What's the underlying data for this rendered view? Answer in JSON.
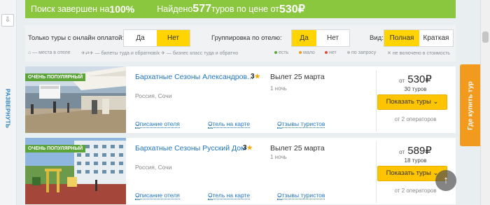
{
  "left": {
    "vertical_text": "РАЗВЕРНУТЬ"
  },
  "status": {
    "search_text": "Поиск завершен на ",
    "search_percent": "100%",
    "found_prefix": "Найдено ",
    "found_count": "577",
    "found_middle": " туров по цене от ",
    "found_price": "530₽"
  },
  "filters": {
    "online_label": "Только туры с онлайн оплатой:",
    "online_options": [
      "Да",
      "Нет"
    ],
    "online_selected": "Нет",
    "group_label": "Группировка по отелю:",
    "group_options": [
      "Да",
      "Нет"
    ],
    "group_selected": "Да",
    "view_label": "Вид:",
    "view_options": [
      "Полная",
      "Краткая"
    ],
    "view_selected": "Полная"
  },
  "legend": [
    "— места в отеле",
    "— билеты туда и обратно",
    "— бизнес класс туда и обратно",
    "есть",
    "мало",
    "нет",
    "по запросу",
    "не включено в стоимость"
  ],
  "legend_colors": {
    "yes": "#5ca43a",
    "few": "#f29a1e",
    "no": "#e14b3b",
    "request": "#bdbdbd"
  },
  "cards": [
    {
      "badge": "ОЧЕНЬ ПОПУЛЯРНЫЙ",
      "name": "Бархатные Сезоны Александров...",
      "stars": "3",
      "location": "Россия, Сочи",
      "departure": "Вылет 25 марта",
      "duration": "1 ночь",
      "price_prefix": "от",
      "price": "530₽",
      "tours": "30 туров",
      "button": "Показать туры",
      "operators": "от 2 операторов",
      "links": [
        "Описание отеля",
        "Отель на карте",
        "Отзывы туристов"
      ]
    },
    {
      "badge": "ОЧЕНЬ ПОПУЛЯРНЫЙ",
      "name": "Бархатные Сезоны Русский Дом",
      "stars": "3",
      "location": "Россия, Сочи",
      "departure": "Вылет 25 марта",
      "duration": "1 ночь",
      "price_prefix": "от",
      "price": "589₽",
      "tours": "18 туров",
      "button": "Показать туры",
      "operators": "от 2 операторов",
      "links": [
        "Описание отеля",
        "Отель на карте",
        "Отзывы туристов"
      ]
    }
  ],
  "side_tab": "Где купить тур",
  "icons": [
    "download-icon",
    "star-icon",
    "chevron-down-icon",
    "arrow-up-icon",
    "home-icon",
    "plane-icon"
  ],
  "colors": {
    "accent_green": "#8bc63f",
    "accent_yellow": "#ffd400",
    "link_blue": "#2076c2",
    "orange": "#f29a1e"
  }
}
